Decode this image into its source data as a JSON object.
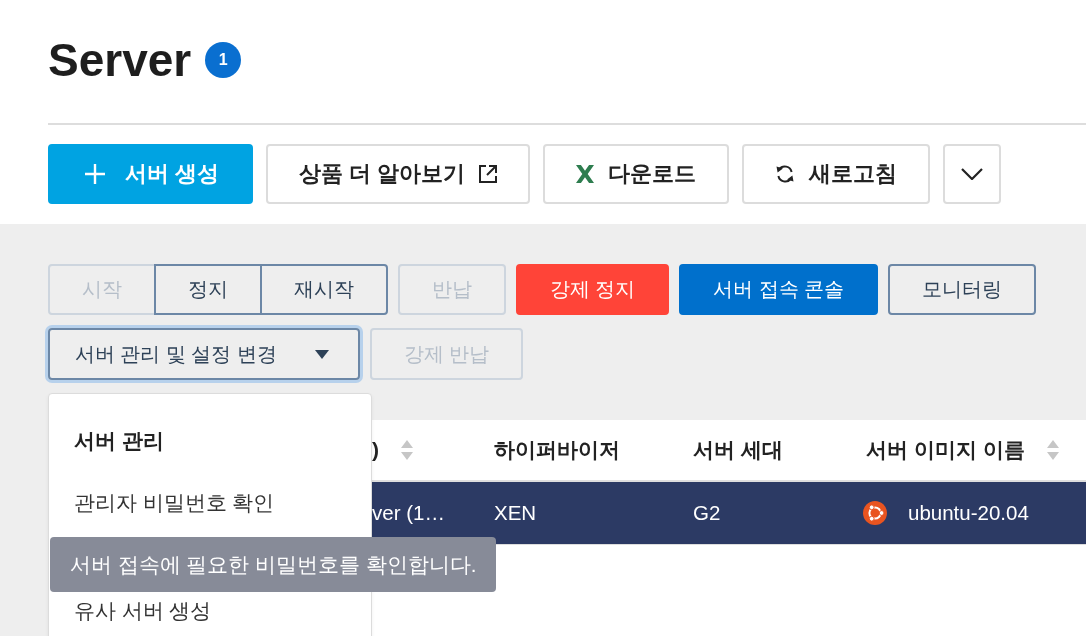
{
  "page": {
    "title": "Server",
    "count": "1"
  },
  "toolbar": [
    {
      "kind": "create",
      "label": "서버 생성"
    },
    {
      "kind": "external",
      "label": "상품 더 알아보기"
    },
    {
      "kind": "download",
      "label": "다운로드"
    },
    {
      "kind": "refresh",
      "label": "새로고침"
    },
    {
      "kind": "more"
    }
  ],
  "actions": [
    {
      "kind": "group",
      "buttons": [
        {
          "label": "시작",
          "disabled": true
        },
        {
          "label": "정지",
          "disabled": false
        },
        {
          "label": "재시작",
          "disabled": false
        }
      ]
    },
    {
      "kind": "plain",
      "label": "반납",
      "disabled": true
    },
    {
      "kind": "danger",
      "label": "강제 정지",
      "disabled": false
    },
    {
      "kind": "primary",
      "label": "서버 접속 콘솔",
      "disabled": false
    },
    {
      "kind": "plain",
      "label": "모니터링",
      "disabled": false
    }
  ],
  "settings": [
    {
      "kind": "dropdown",
      "label": "서버 관리 및 설정 변경",
      "expanded": true,
      "menu": {
        "heading": "서버 관리",
        "items": [
          {
            "label": "관리자 비밀번호 확인",
            "tooltip": "서버 접속에 필요한 비밀번호를 확인합니다."
          },
          {
            "label": "유사 서버 생성"
          }
        ]
      }
    },
    {
      "kind": "plain",
      "label": "강제 반납",
      "disabled": true
    }
  ],
  "table": {
    "columns": [
      {
        "kind": "text",
        "label": ")",
        "sortable": true
      },
      {
        "kind": "text",
        "label": "하이퍼바이저",
        "sortable": false
      },
      {
        "kind": "text",
        "label": "서버 세대",
        "sortable": false
      },
      {
        "kind": "image",
        "label": "서버 이미지 이름",
        "sortable": true
      }
    ],
    "rows": [
      {
        "selected": true,
        "cells": [
          "ver (1…",
          "XEN",
          "G2",
          "ubuntu-20.04"
        ]
      }
    ]
  }
}
